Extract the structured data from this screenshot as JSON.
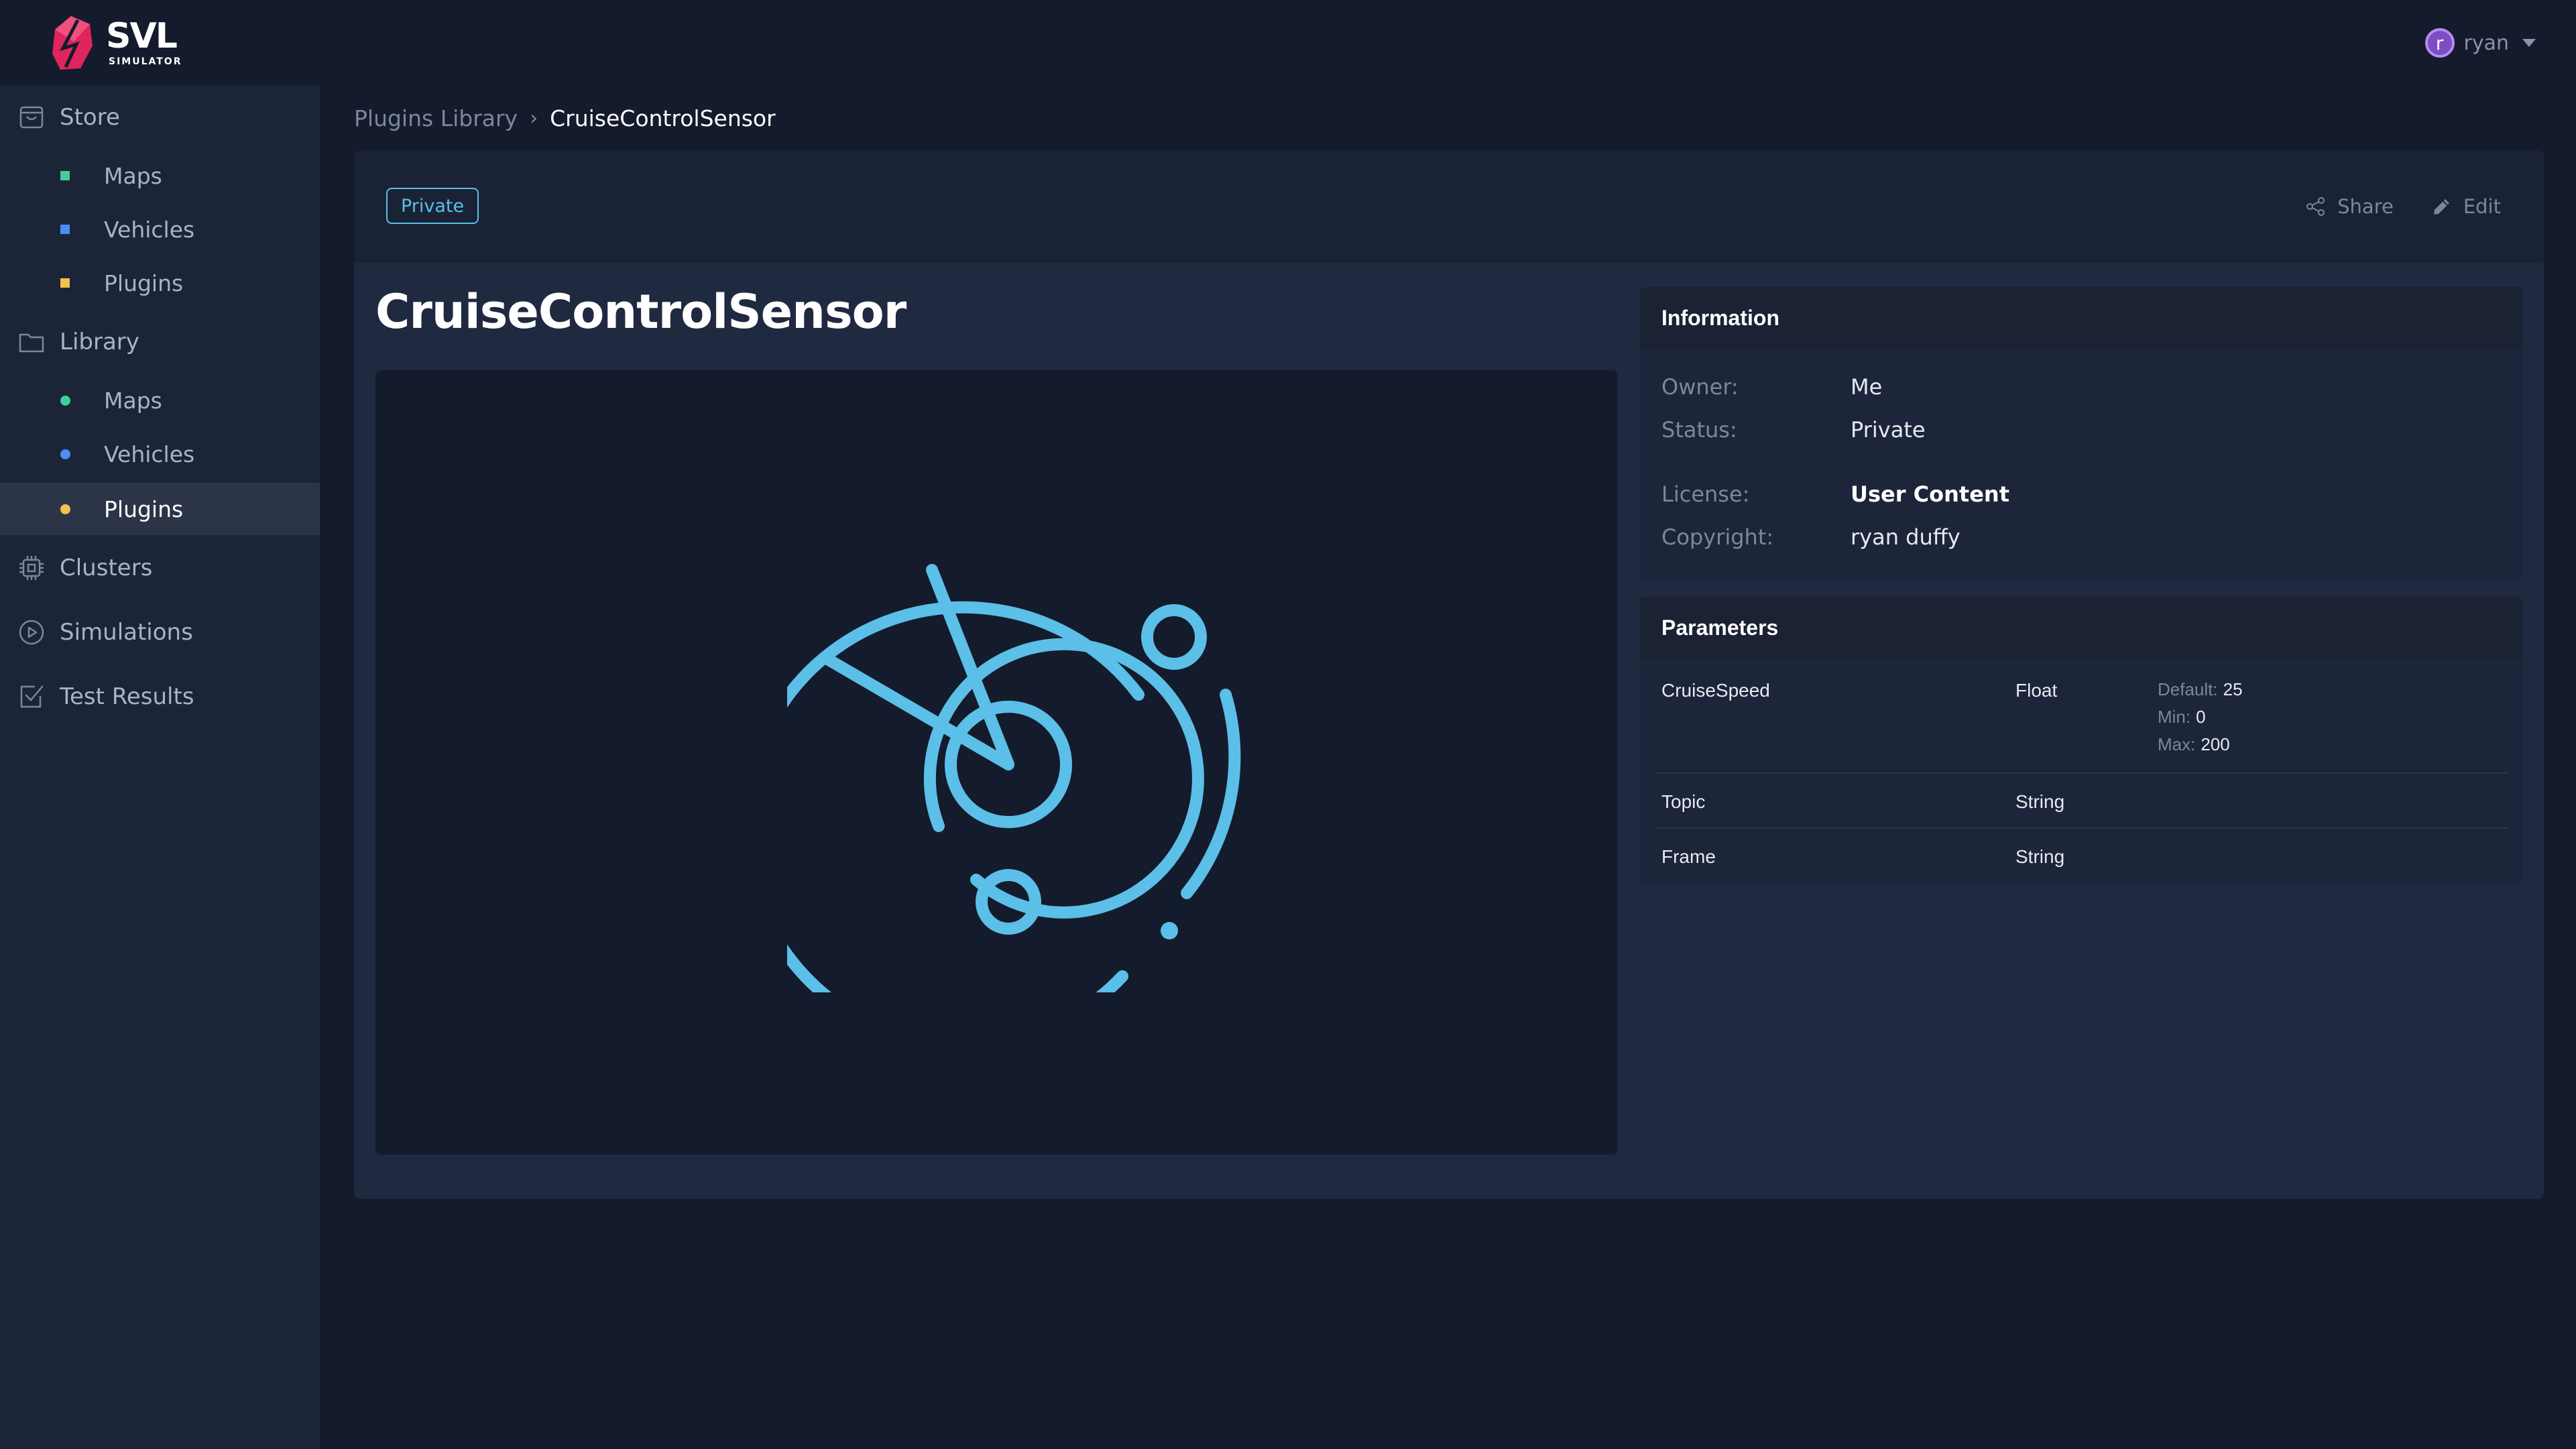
{
  "brand": {
    "name": "SVL",
    "subtitle": "SIMULATOR"
  },
  "user": {
    "initial": "r",
    "name": "ryan"
  },
  "sidebar": {
    "sections": [
      {
        "label": "Store",
        "icon": "store-icon"
      },
      {
        "label": "Library",
        "icon": "folder-icon"
      },
      {
        "label": "Clusters",
        "icon": "cpu-icon"
      },
      {
        "label": "Simulations",
        "icon": "play-circle-icon"
      },
      {
        "label": "Test Results",
        "icon": "checkbox-icon"
      }
    ],
    "store_items": [
      {
        "label": "Maps",
        "color": "#3ecf9a"
      },
      {
        "label": "Vehicles",
        "color": "#4c8df6"
      },
      {
        "label": "Plugins",
        "color": "#f2c14e"
      }
    ],
    "library_items": [
      {
        "label": "Maps",
        "color": "#3ecf9a"
      },
      {
        "label": "Vehicles",
        "color": "#4c8df6"
      },
      {
        "label": "Plugins",
        "color": "#f2c14e",
        "active": true
      }
    ]
  },
  "breadcrumb": {
    "parent": "Plugins Library",
    "separator": "›",
    "current": "CruiseControlSensor"
  },
  "plugin": {
    "badge": "Private",
    "share_label": "Share",
    "edit_label": "Edit",
    "title": "CruiseControlSensor",
    "preview_icon": "radar-icon",
    "icon_color": "#5bbfe8"
  },
  "information": {
    "heading": "Information",
    "owner_key": "Owner:",
    "owner": "Me",
    "status_key": "Status:",
    "status": "Private",
    "license_key": "License:",
    "license": "User Content",
    "copyright_key": "Copyright:",
    "copyright": "ryan duffy"
  },
  "parameters": {
    "heading": "Parameters",
    "rows": [
      {
        "name": "CruiseSpeed",
        "type": "Float",
        "default_key": "Default:",
        "default": "25",
        "min_key": "Min:",
        "min": "0",
        "max_key": "Max:",
        "max": "200"
      },
      {
        "name": "Topic",
        "type": "String"
      },
      {
        "name": "Frame",
        "type": "String"
      }
    ]
  }
}
